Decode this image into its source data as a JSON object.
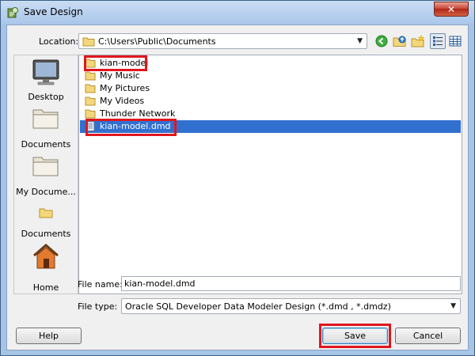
{
  "window": {
    "title": "Save Design",
    "close_symbol": "✕"
  },
  "toolbar": {
    "location_label": "Location:",
    "location_value": "C:\\Users\\Public\\Documents",
    "icons": [
      "back-icon",
      "up-folder-icon",
      "new-folder-icon",
      "list-view-icon",
      "details-view-icon"
    ]
  },
  "places": [
    {
      "label": "Desktop",
      "icon": "desktop-icon"
    },
    {
      "label": "Documents",
      "icon": "folder-icon"
    },
    {
      "label": "My Docume...",
      "icon": "folder-icon"
    },
    {
      "label": "Documents",
      "icon": "small-folder-icon"
    },
    {
      "label": "Home",
      "icon": "home-icon"
    }
  ],
  "files": [
    {
      "name": "kian-model",
      "type": "folder",
      "highlighted": true
    },
    {
      "name": "My Music",
      "type": "folder"
    },
    {
      "name": "My Pictures",
      "type": "folder"
    },
    {
      "name": "My Videos",
      "type": "folder"
    },
    {
      "name": "Thunder Network",
      "type": "folder"
    },
    {
      "name": "kian-model.dmd",
      "type": "file",
      "selected": true,
      "highlighted": true
    }
  ],
  "form": {
    "filename_label": "File name:",
    "filename_value": "kian-model.dmd",
    "filetype_label": "File type:",
    "filetype_value": "Oracle SQL Developer Data Modeler Design (*.dmd , *.dmdz)"
  },
  "buttons": {
    "help": "Help",
    "save": "Save",
    "cancel": "Cancel"
  },
  "colors": {
    "selection": "#3170cf",
    "highlight_box": "#e0161e"
  }
}
